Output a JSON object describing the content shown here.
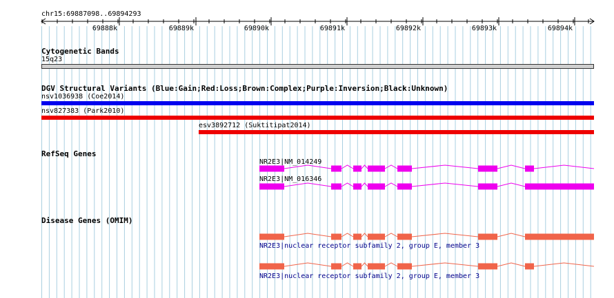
{
  "ruler": {
    "range_label": "chr15:69887098..69894293",
    "ticks": [
      "69888k",
      "69889k",
      "69890k",
      "69891k",
      "69892k",
      "69893k",
      "69894k"
    ]
  },
  "cytoband": {
    "title": "Cytogenetic Bands",
    "band": "15q23"
  },
  "dgv": {
    "title": "DGV Structural Variants (Blue:Gain;Red:Loss;Brown:Complex;Purple:Inversion;Black:Unknown)",
    "variants": [
      {
        "label": "nsv1036938 (Coe2014)",
        "type": "Gain",
        "color": "#0000ee"
      },
      {
        "label": "nsv827383 (Park2010)",
        "type": "Loss",
        "color": "#ee0000"
      },
      {
        "label": "esv3892712 (Suktitipat2014)",
        "type": "Loss",
        "color": "#ee0000"
      }
    ]
  },
  "refseq": {
    "title": "RefSeq Genes",
    "color": "#ee00ee",
    "transcripts": [
      {
        "label": "NR2E3|NM_014249"
      },
      {
        "label": "NR2E3|NM_016346"
      }
    ]
  },
  "omim": {
    "title": "Disease Genes (OMIM)",
    "color": "#f0644a",
    "genes": [
      {
        "label": "NR2E3|nuclear receptor subfamily 2, group E, member 3"
      },
      {
        "label": "NR2E3|nuclear receptor subfamily 2, group E, member 3"
      }
    ]
  }
}
